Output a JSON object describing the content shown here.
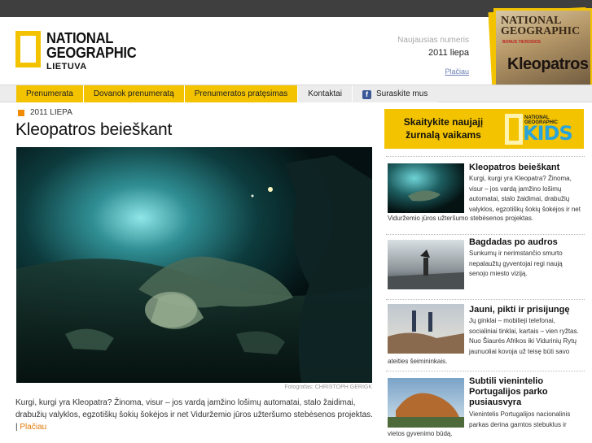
{
  "brand": {
    "line1": "NATIONAL",
    "line2": "GEOGRAPHIC",
    "line3": "LIETUVA"
  },
  "latest_issue": {
    "label": "Naujausias numeris",
    "date": "2011 liepa",
    "more": "Plačiau",
    "cover": {
      "line1": "NATIONAL",
      "line2": "GEOGRAPHIC",
      "tag": "BONUS TIKROSIOS",
      "title": "Kleopatros"
    }
  },
  "nav": [
    {
      "label": "Prenumerata",
      "style": "yellow"
    },
    {
      "label": "Dovanok prenumeratą",
      "style": "yellow"
    },
    {
      "label": "Prenumeratos pratęsimas",
      "style": "yellow"
    },
    {
      "label": "Kontaktai",
      "style": "plain"
    },
    {
      "label": "Suraskite mus",
      "style": "plain",
      "icon": "facebook-icon"
    }
  ],
  "article": {
    "date": "2011 LIEPA",
    "title": "Kleopatros beieškant",
    "credit": "Fotografas: CHRISTOPH GERIGK",
    "summary": "Kurgi, kurgi yra Kleopatra? Žinoma, visur – jos vardą įamžino lošimų automatai, stalo žaidimai, drabužių valyklos, egzotiškų šokių šokėjos ir net Viduržemio jūros užteršumo stebėsenos projektas. |",
    "more": "Plačiau"
  },
  "kids_banner": {
    "line1": "Skaitykite naujajį",
    "line2": "žurnalą vaikams",
    "ng": "NATIONAL GEOGRAPHIC",
    "word": "KIDS"
  },
  "sidebar": [
    {
      "title": "Kleopatros beieškant",
      "text": "Kurgi, kurgi yra Kleopatra? Žinoma, visur – jos vardą įamžino lošimų automatai, stalo žaidimai, drabužių valyklos, egzotiškų šokių šokėjos ir net",
      "text_wide": "Viduržemio jūros užteršumo stebėsenos projektas."
    },
    {
      "title": "Bagdadas po audros",
      "text": "Sunkumų ir nerimstančio smurto nepalaužtų gyventojai regi naują senojo miesto viziją.",
      "text_wide": ""
    },
    {
      "title": "Jauni, pikti ir prisijungę",
      "text": "Jų ginklai – mobilieji telefonai, socialiniai tinklai, kartais – vien ryžtas. Nuo Šiaurės Afrikos iki Vidurinių Rytų jaunuoliai kovoja už teisę būti savo",
      "text_wide": "ateities šeimininkais."
    },
    {
      "title": "Subtili vienintelio Portugalijos parko pusiausvyra",
      "text": "Vienintelis Portugalijos nacionalinis parkas derina gamtos stebuklus ir",
      "text_wide": "vietos gyvenimo būdą."
    }
  ]
}
